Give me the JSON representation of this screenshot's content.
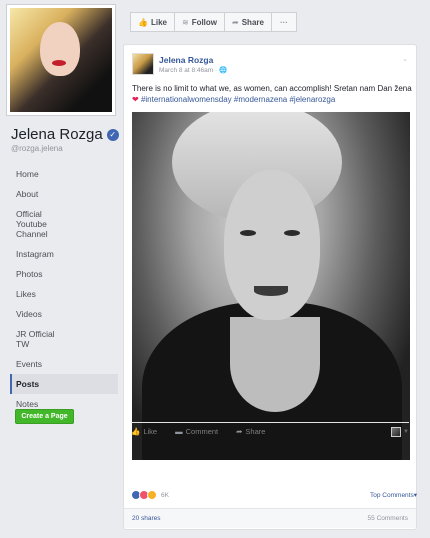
{
  "profile": {
    "name": "Jelena Rozga",
    "handle": "@rozga.jelena",
    "verified_icon": "check-icon"
  },
  "sidebar": {
    "items": [
      {
        "label": "Home"
      },
      {
        "label": "About"
      },
      {
        "label": "Official Youtube Channel"
      },
      {
        "label": "Instagram"
      },
      {
        "label": "Photos"
      },
      {
        "label": "Likes"
      },
      {
        "label": "Videos"
      },
      {
        "label": "JR Official TW"
      },
      {
        "label": "Events"
      },
      {
        "label": "Posts",
        "active": true
      },
      {
        "label": "Notes"
      }
    ],
    "create_page_label": "Create a Page"
  },
  "actionbar": {
    "like_label": "Like",
    "follow_label": "Follow",
    "share_label": "Share",
    "more_label": "···"
  },
  "post": {
    "author": "Jelena Rozga",
    "timestamp": "March 8 at 8:46am · ",
    "text_main": "There is no limit to what we, as women, can accomplish! Sretan nam Dan žena ",
    "heart": "❤",
    "hashtags": "#internationalwomensday #modernazena #jelenarozga",
    "actions": {
      "like": "Like",
      "comment": "Comment",
      "share": "Share"
    },
    "reaction_count": "6K",
    "top_comments_label": "Top Comments▾",
    "shares_label": "20 shares",
    "comments_label": "55 Comments"
  },
  "colors": {
    "link": "#365899",
    "create_page": "#42b72a",
    "verified": "#4267b2"
  }
}
